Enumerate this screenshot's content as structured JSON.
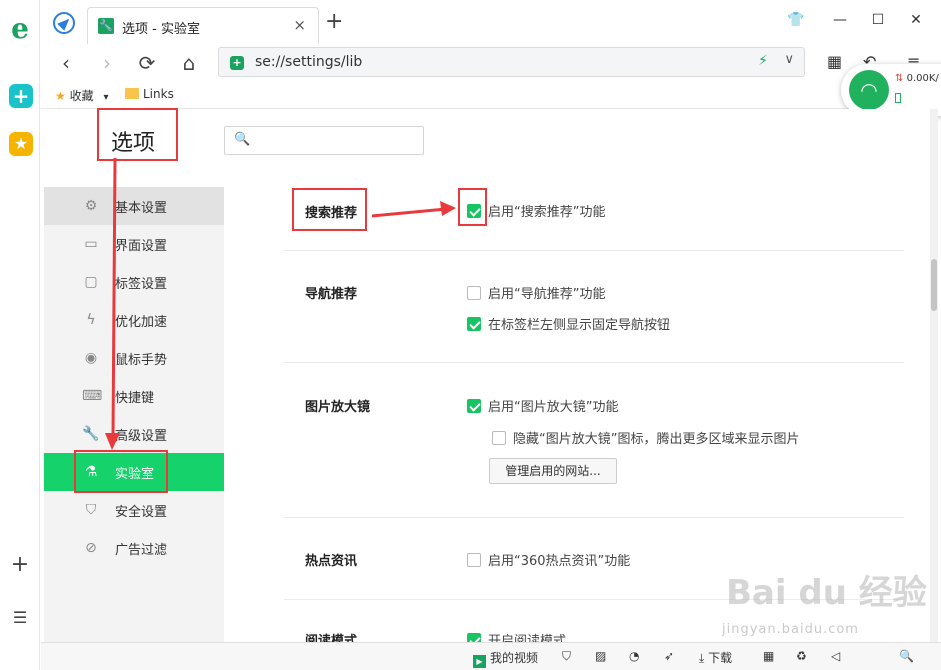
{
  "tab": {
    "title": "选项 - 实验室",
    "close": "×",
    "new": "+"
  },
  "window": {
    "shirt": "👕",
    "min": "—",
    "max": "☐",
    "close": "✕"
  },
  "nav": {
    "back": "‹",
    "forward": "›",
    "reload": "⟳",
    "home": "⌂",
    "url": "se://settings/lib",
    "bolt": "⚡",
    "chevron": "∨"
  },
  "toolbar": {
    "grid": "▦",
    "undo": "↶",
    "menu": "≡"
  },
  "bookmarks": {
    "favorites": "收藏",
    "favorites_caret": "▾",
    "links": "Links"
  },
  "netwidget": {
    "speed": "0.00K/",
    "wifi": "📶"
  },
  "page": {
    "title": "选项",
    "search_placeholder": ""
  },
  "sidebar": {
    "items": [
      {
        "label": "基本设置",
        "icon": "⚙"
      },
      {
        "label": "界面设置",
        "icon": "▭"
      },
      {
        "label": "标签设置",
        "icon": "▢"
      },
      {
        "label": "优化加速",
        "icon": "ϟ"
      },
      {
        "label": "鼠标手势",
        "icon": "◉"
      },
      {
        "label": "快捷键",
        "icon": "⌨"
      },
      {
        "label": "高级设置",
        "icon": "🔧"
      },
      {
        "label": "实验室",
        "icon": "⚗"
      },
      {
        "label": "安全设置",
        "icon": "⛉"
      },
      {
        "label": "广告过滤",
        "icon": "⊘"
      }
    ]
  },
  "sections": {
    "search": {
      "title": "搜索推荐",
      "opt1": "启用“搜索推荐”功能",
      "opt1_checked": true
    },
    "nav": {
      "title": "导航推荐",
      "opt1": "启用“导航推荐”功能",
      "opt1_checked": false,
      "opt2": "在标签栏左侧显示固定导航按钮",
      "opt2_checked": true
    },
    "magnifier": {
      "title": "图片放大镜",
      "opt1": "启用“图片放大镜”功能",
      "opt1_checked": true,
      "opt2": "隐藏“图片放大镜”图标，腾出更多区域来显示图片",
      "opt2_checked": false,
      "button": "管理启用的网站..."
    },
    "hotnews": {
      "title": "热点资讯",
      "opt1": "启用“360热点资讯”功能",
      "opt1_checked": false
    },
    "reading": {
      "title": "阅读模式",
      "opt1": "开启阅读模式",
      "opt1_checked": true
    }
  },
  "statusbar": {
    "video": "我的视频",
    "download": "下载"
  },
  "watermark": {
    "main": "Bai du 经验",
    "sub": "jingyan.baidu.com"
  },
  "colors": {
    "accent": "#16d26a",
    "annotation": "#e8393d"
  }
}
